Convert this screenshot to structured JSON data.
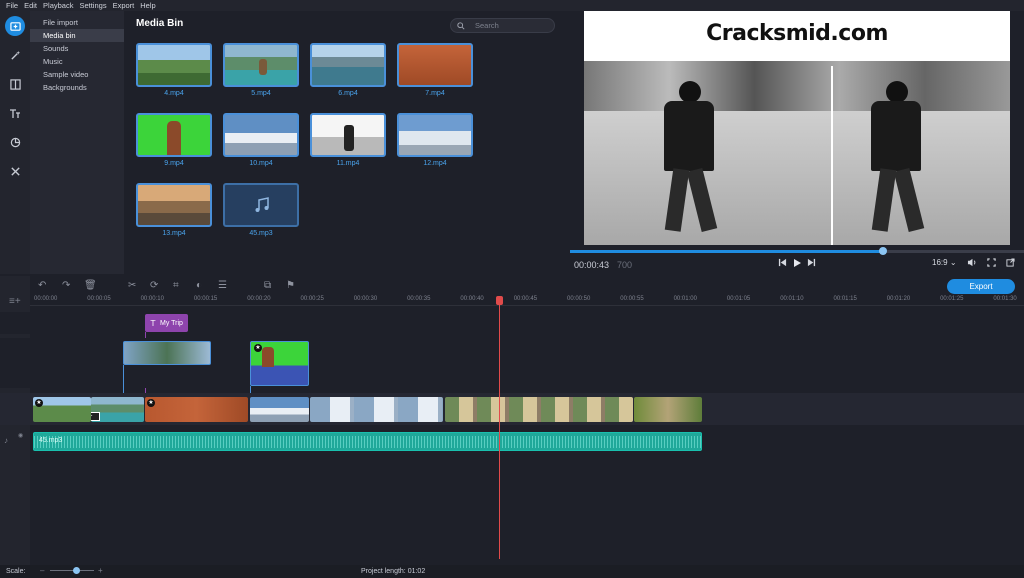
{
  "menu": [
    "File",
    "Edit",
    "Playback",
    "Settings",
    "Export",
    "Help"
  ],
  "categories": [
    {
      "label": "File import",
      "active": false
    },
    {
      "label": "Media bin",
      "active": true
    },
    {
      "label": "Sounds",
      "active": false
    },
    {
      "label": "Music",
      "active": false
    },
    {
      "label": "Sample video",
      "active": false
    },
    {
      "label": "Backgrounds",
      "active": false
    }
  ],
  "bin": {
    "title": "Media Bin",
    "search_placeholder": "Search",
    "items": [
      "4.mp4",
      "5.mp4",
      "6.mp4",
      "7.mp4",
      "9.mp4",
      "10.mp4",
      "11.mp4",
      "12.mp4",
      "13.mp4",
      "45.mp3"
    ]
  },
  "preview": {
    "watermark": "Cracksmid.com",
    "timecode": "00:00:43",
    "timecode_ms": "700",
    "aspect": "16:9",
    "progress": 0.69
  },
  "timeline": {
    "export_label": "Export",
    "ruler": [
      "00:00:00",
      "00:00:05",
      "00:00:10",
      "00:00:15",
      "00:00:20",
      "00:00:25",
      "00:00:30",
      "00:00:35",
      "00:00:40",
      "00:00:45",
      "00:00:50",
      "00:00:55",
      "00:01:00",
      "00:01:05",
      "00:01:10",
      "00:01:15",
      "00:01:20",
      "00:01:25",
      "00:01:30"
    ],
    "title_clip": "My Trip",
    "audio_clip": "45.mp3"
  },
  "status": {
    "scale_label": "Scale:",
    "project_length": "Project length:  01:02"
  },
  "colors": {
    "accent": "#1f8ce0",
    "playhead": "#e14b4b",
    "title_clip": "#8e44ad",
    "audio": "#1fa89a"
  },
  "icons": [
    "import-icon",
    "magic-wand-icon",
    "transition-icon",
    "text-icon",
    "sticker-icon",
    "tools-icon",
    "undo-icon",
    "redo-icon",
    "trash-icon",
    "cut-icon",
    "rotate-icon",
    "crop-icon",
    "color-icon",
    "settings-icon",
    "search-icon",
    "skip-back-icon",
    "play-icon",
    "skip-forward-icon",
    "volume-icon",
    "fullscreen-icon",
    "popout-icon"
  ]
}
